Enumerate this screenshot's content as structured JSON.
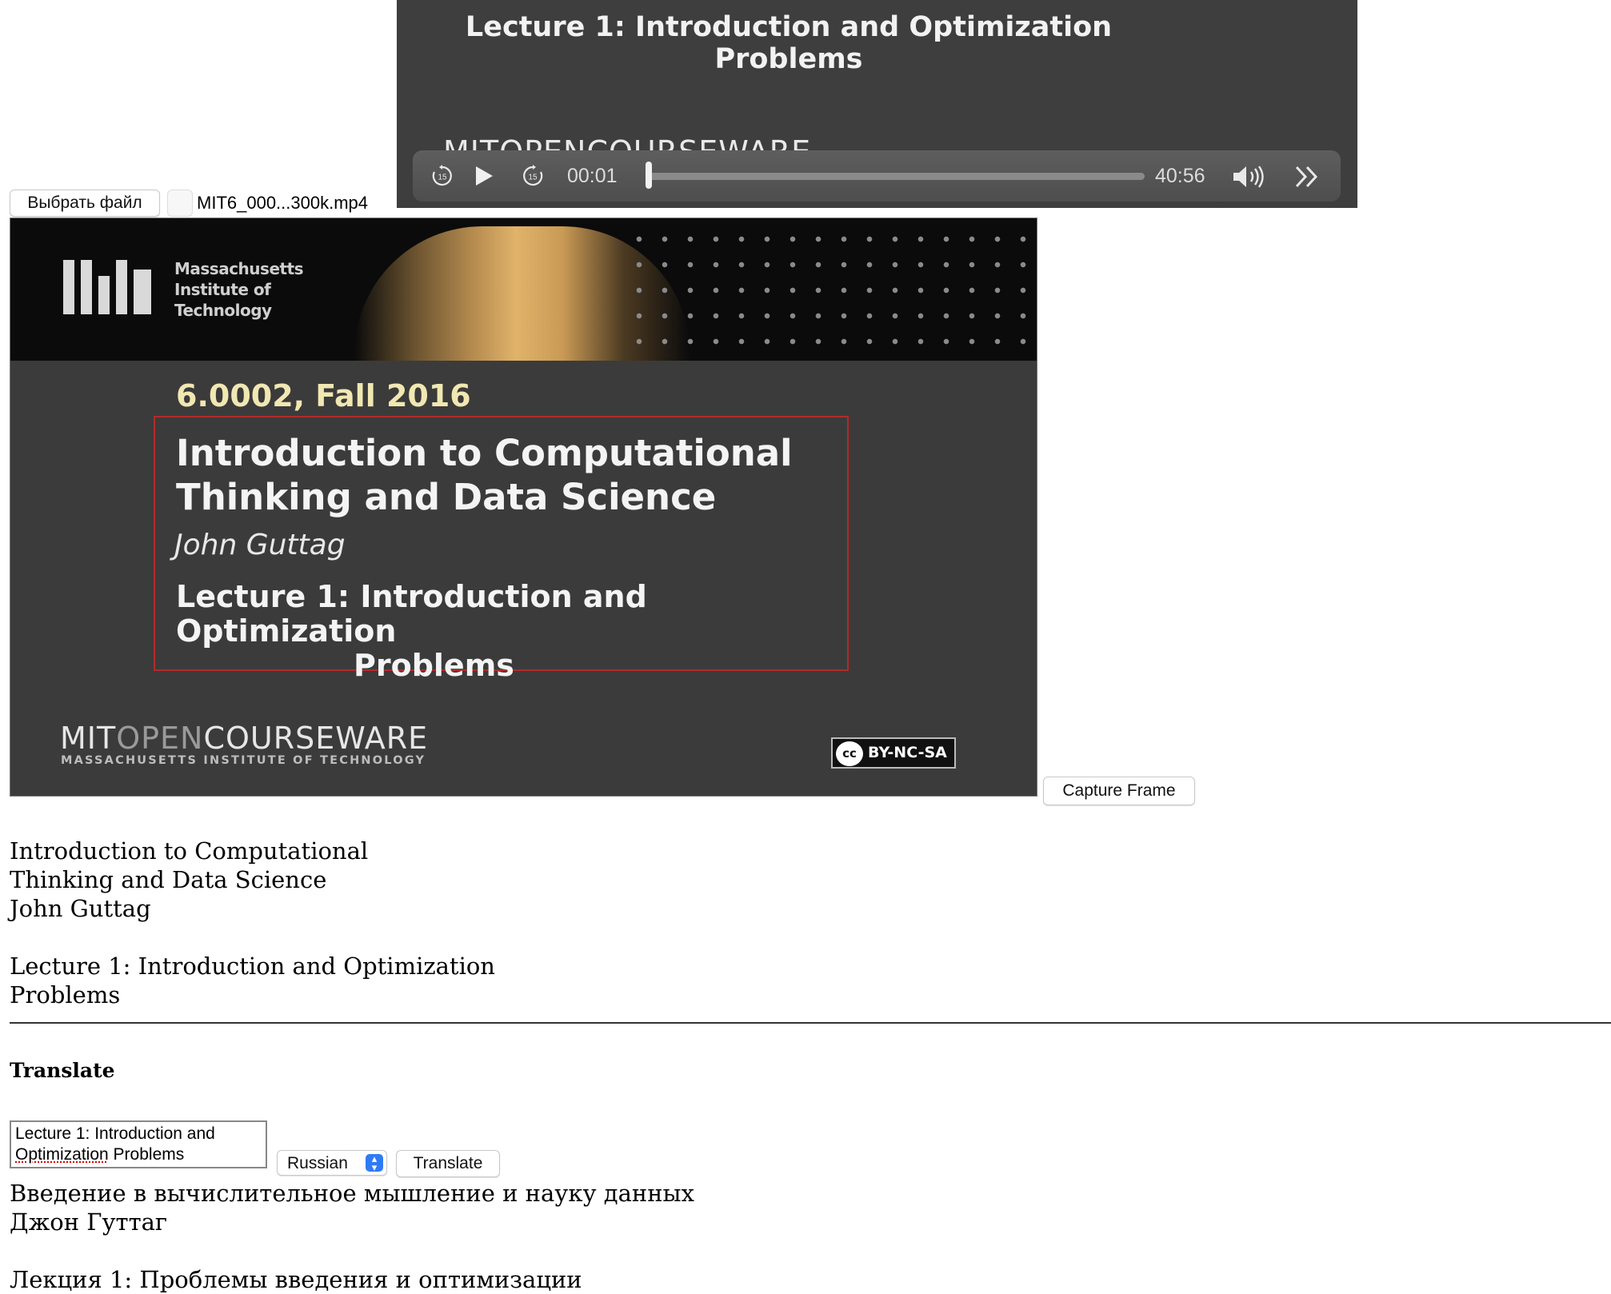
{
  "player": {
    "overlay_title_line1": "Lecture 1: Introduction and Optimization",
    "overlay_title_line2": "Problems",
    "overlay_brand": "MITOPENCOURSEWARE",
    "current_time": "00:01",
    "duration": "40:56",
    "progress_fraction": 0.0004,
    "skip_back_seconds": "15",
    "skip_forward_seconds": "15",
    "icons": [
      "skip-back-15-icon",
      "play-icon",
      "skip-forward-15-icon",
      "volume-icon",
      "fast-forward-icon"
    ]
  },
  "file_input": {
    "button_label": "Выбрать файл",
    "file_name": "MIT6_000...300k.mp4"
  },
  "slide": {
    "institution_line1": "Massachusetts",
    "institution_line2": "Institute of",
    "institution_line3": "Technology",
    "course": "6.0002, Fall 2016",
    "title_line1": "Introduction to Computational",
    "title_line2": "Thinking and Data Science",
    "author": "John Guttag",
    "lecture_line1": "Lecture 1: Introduction and Optimization",
    "lecture_line2": "Problems",
    "ocw_bold_1": "MIT",
    "ocw_thin": "OPEN",
    "ocw_bold_2": "COURSEWARE",
    "ocw_sub": "MASSACHUSETTS INSTITUTE OF TECHNOLOGY",
    "license_mark": "cc",
    "license": "BY-NC-SA"
  },
  "capture_button": "Capture Frame",
  "extracted_text": {
    "block1": "Introduction to Computational\nThinking and Data Science\nJohn Guttag",
    "block2": "Lecture 1: Introduction and Optimization\nProblems"
  },
  "translate": {
    "heading": "Translate",
    "input_line1": "Lecture 1: Introduction and",
    "input_word_misspelled": "Optimization",
    "input_rest": " Problems",
    "language": "Russian",
    "button_label": "Translate",
    "result_block1": "Введение в вычислительное мышление и науку данных\nДжон Гуттаг",
    "result_block2": "Лекция 1: Проблемы введения и оптимизации"
  },
  "colors": {
    "player_bg": "#3e3e3e",
    "slide_bg": "#3b3b3b",
    "slide_frame": "#b32a2a",
    "course_text": "#f1e7b2",
    "select_accent": "#2f7bf5"
  }
}
